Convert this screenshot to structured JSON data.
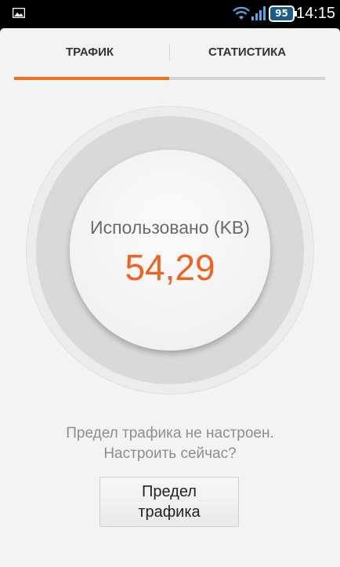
{
  "status_bar": {
    "battery_level": "95",
    "time": "14:15",
    "icons": [
      "gallery-icon",
      "wifi-icon",
      "signal-icon",
      "battery-icon"
    ]
  },
  "tabs": [
    {
      "label": "ТРАФИК",
      "active": true
    },
    {
      "label": "СТАТИСТИКА",
      "active": false
    }
  ],
  "usage": {
    "label": "Использовано (KB)",
    "value": "54,29"
  },
  "message": {
    "line1": "Предел трафика не настроен.",
    "line2": "Настроить сейчас?"
  },
  "limit_button": {
    "line1": "Предел",
    "line2": "трафика"
  },
  "colors": {
    "accent": "#f1731f",
    "value": "#f1611f"
  }
}
